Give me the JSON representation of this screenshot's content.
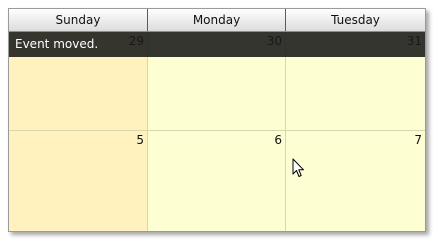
{
  "calendar": {
    "headers": [
      "Sunday",
      "Monday",
      "Tuesday"
    ],
    "weeks": [
      [
        "29",
        "30",
        "31"
      ],
      [
        "5",
        "6",
        "7"
      ]
    ]
  },
  "notification": {
    "message": "Event moved."
  },
  "colors": {
    "cell_background": "#fefed3",
    "weekend_background": "#fff2bf",
    "notification_background": "#191919"
  },
  "icons": {
    "cursor": "mouse-pointer-icon"
  }
}
